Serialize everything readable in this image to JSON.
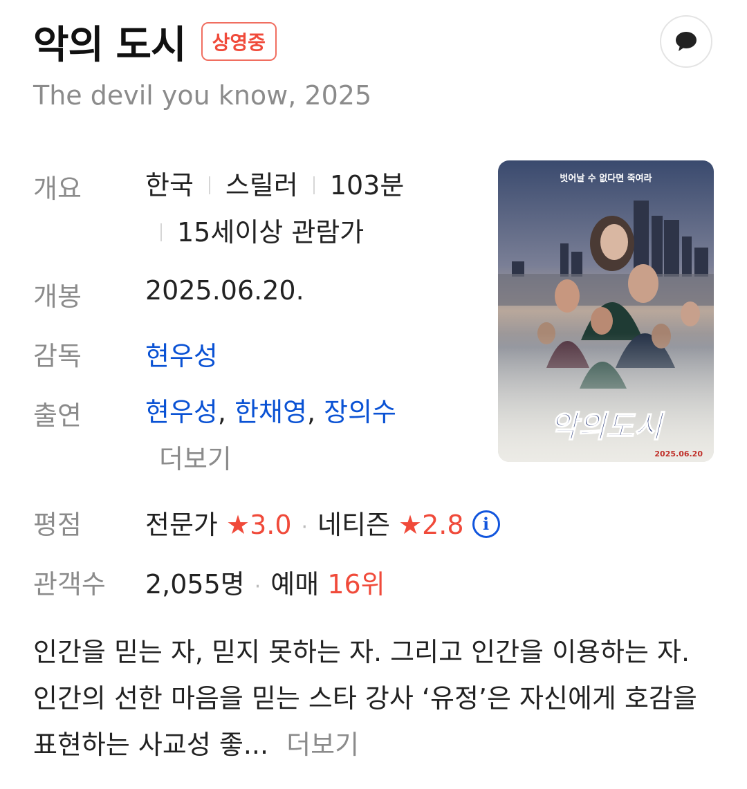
{
  "movie": {
    "title": "악의 도시",
    "status_badge": "상영중",
    "subtitle": "The devil you know, 2025"
  },
  "info": {
    "overview_label": "개요",
    "overview_country": "한국",
    "overview_genre": "스릴러",
    "overview_runtime": "103분",
    "overview_rating": "15세이상 관람가",
    "release_label": "개봉",
    "release_date": "2025.06.20.",
    "director_label": "감독",
    "director": "현우성",
    "cast_label": "출연",
    "cast": [
      "현우성",
      "한채영",
      "장의수"
    ],
    "cast_more": "더보기",
    "rating_label": "평점",
    "critic_label": "전문가",
    "critic_score": "3.0",
    "netizen_label": "네티즌",
    "netizen_score": "2.8",
    "audience_label": "관객수",
    "audience_count": "2,055명",
    "reservation_label": "예매",
    "reservation_rank": "16위"
  },
  "poster": {
    "tagline": "벗어날 수 없다면 죽여라",
    "title": "악의도시",
    "date": "2025.06.20"
  },
  "synopsis": {
    "text": "인간을 믿는 자, 믿지 못하는 자. 그리고 인간을 이용하는 자. 인간의 선한 마음을 믿는 스타 강사 ‘유정’은 자신에게 호감을 표현하는 사교성 좋...",
    "more": "더보기"
  },
  "icons": {
    "talk": "speech-bubble-icon",
    "star": "star-icon",
    "info": "info-icon"
  },
  "colors": {
    "accent_red": "#f04a3a",
    "link_blue": "#0a52d4",
    "muted_gray": "#8b8b8b"
  }
}
